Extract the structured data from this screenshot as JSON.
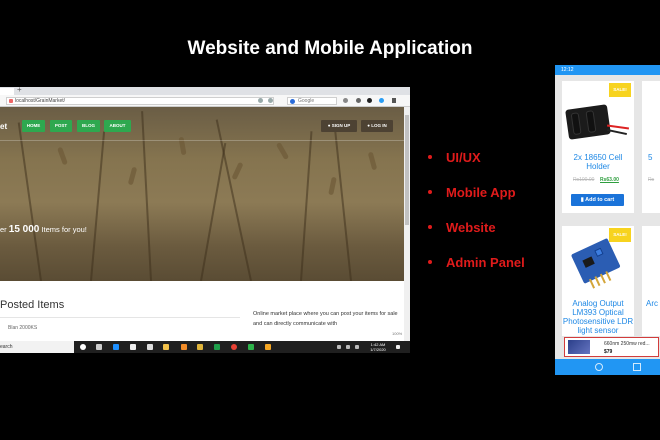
{
  "slide": {
    "title": "Website and Mobile Application"
  },
  "browser": {
    "new_tab": "+",
    "url": "localhost/GrainMarket/",
    "search_placeholder": "Google"
  },
  "website": {
    "brand": "et",
    "nav": [
      "HOME",
      "POST",
      "BLOG",
      "ABOUT"
    ],
    "sign_up": "SIGN UP",
    "log_in": "LOG IN",
    "hero_prefix": "er ",
    "hero_count": "15 000",
    "hero_suffix": " Items for you!",
    "section_title": "Posted Items",
    "posted_stub": "Blan 2000KS",
    "description": "Online market place where you can post your items for sale and can directly communicate with",
    "zoom": "100%"
  },
  "taskbar": {
    "search": "earch",
    "time": "1:42 AM",
    "date": "1/7/2020"
  },
  "bullets": [
    "UI/UX",
    "Mobile App",
    "Website",
    "Admin Panel"
  ],
  "phone": {
    "time": "12:12",
    "products": [
      {
        "sale": "SALE!",
        "name": "2x 18650 Cell Holder",
        "old_price": "Rs100.00",
        "new_price": "Rs63.00",
        "button": "Add to cart"
      },
      {
        "sale": "SALE!",
        "name": "Analog Output LM393 Optical Photosensitive LDR light sensor"
      }
    ],
    "partial_right": {
      "name_top": "5",
      "old": "Rs",
      "name_bottom": "Arc"
    },
    "toast": {
      "title": "660nm 250mw red...",
      "price": "$79"
    }
  },
  "colors": {
    "nav_green": "#2ea84f",
    "bullet_red": "#e01b1b",
    "phone_blue": "#2196f3",
    "link_blue": "#1e88e5",
    "sale_yellow": "#f7d31f"
  }
}
